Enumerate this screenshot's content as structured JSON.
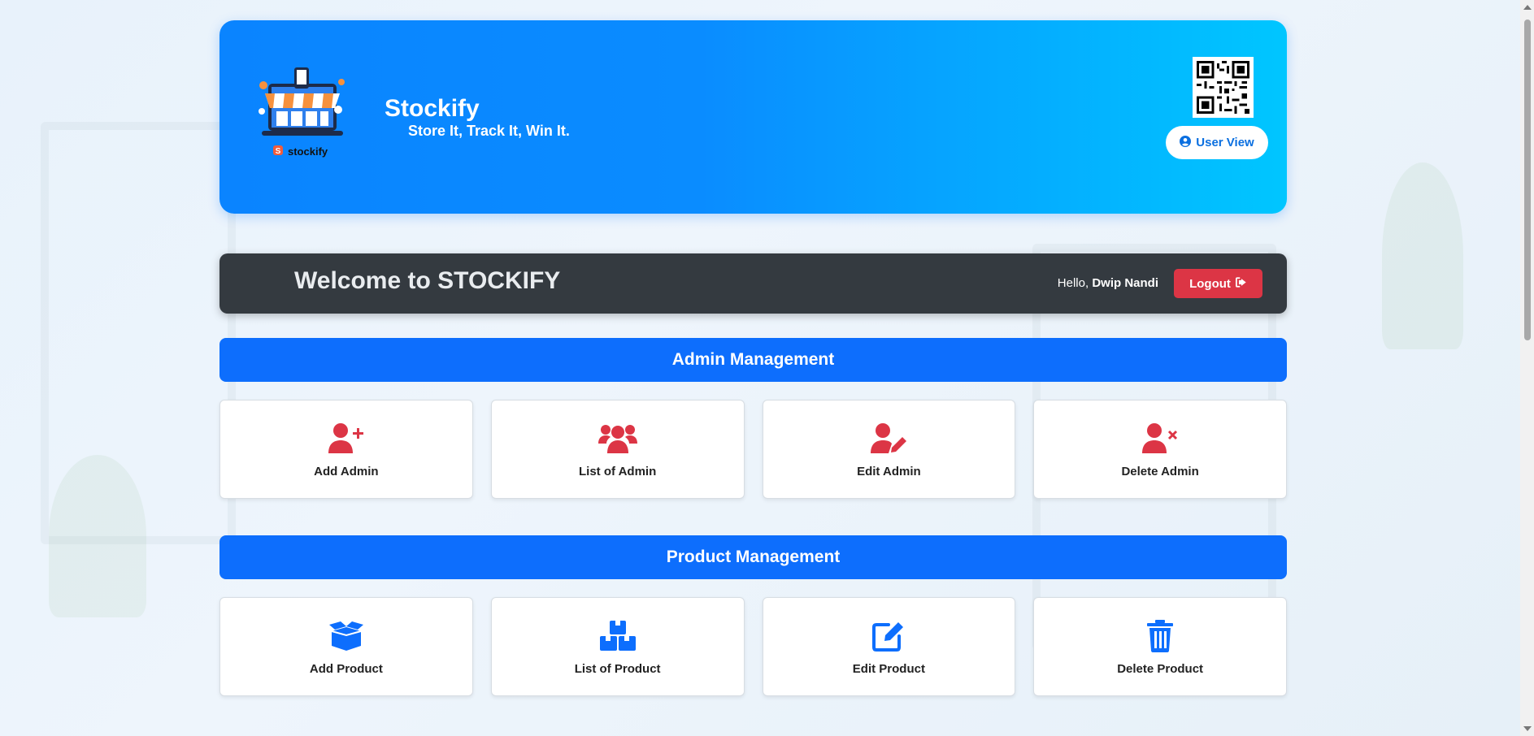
{
  "brand": {
    "name": "Stockify",
    "tagline": "Store It, Track It, Win It.",
    "logo_text": "stockify"
  },
  "header": {
    "user_view_label": "User View"
  },
  "welcome": {
    "title": "Welcome to STOCKIFY",
    "greeting_prefix": "Hello, ",
    "user_name": "Dwip Nandi",
    "logout_label": "Logout"
  },
  "admin_section": {
    "title": "Admin Management",
    "cards": [
      {
        "label": "Add Admin",
        "icon": "user-plus-icon"
      },
      {
        "label": "List of Admin",
        "icon": "users-icon"
      },
      {
        "label": "Edit Admin",
        "icon": "user-edit-icon"
      },
      {
        "label": "Delete Admin",
        "icon": "user-remove-icon"
      }
    ]
  },
  "product_section": {
    "title": "Product Management",
    "cards": [
      {
        "label": "Add Product",
        "icon": "box-open-icon"
      },
      {
        "label": "List of Product",
        "icon": "boxes-icon"
      },
      {
        "label": "Edit Product",
        "icon": "edit-icon"
      },
      {
        "label": "Delete Product",
        "icon": "trash-icon"
      }
    ]
  },
  "colors": {
    "primary": "#0d6efd",
    "danger": "#dc3545",
    "dark": "#343a40",
    "hero_start": "#0a84ff",
    "hero_end": "#00c6ff"
  }
}
